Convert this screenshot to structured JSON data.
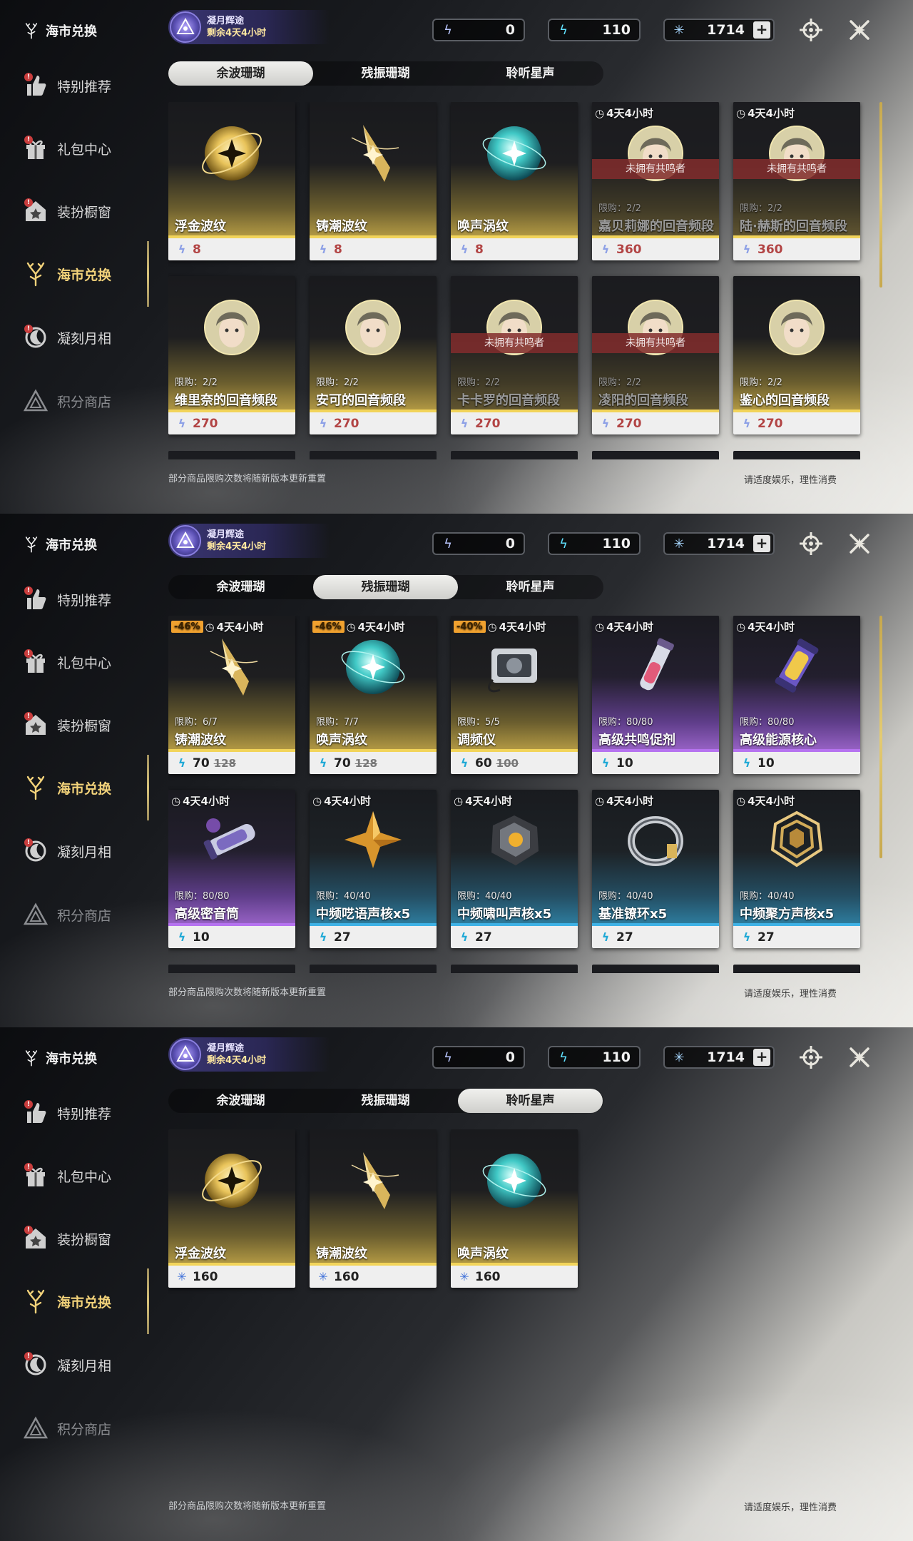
{
  "sidebar": {
    "title": "海市兑换",
    "items": [
      {
        "label": "特别推荐",
        "icon": "recommend-icon",
        "badge": "!",
        "state": "normal"
      },
      {
        "label": "礼包中心",
        "icon": "gift-icon",
        "badge": "!",
        "state": "normal"
      },
      {
        "label": "装扮橱窗",
        "icon": "wardrobe-icon",
        "badge": "!",
        "state": "normal"
      },
      {
        "label": "海市兑换",
        "icon": "coral-icon",
        "badge": "",
        "state": "active"
      },
      {
        "label": "凝刻月相",
        "icon": "moon-icon",
        "badge": "!",
        "state": "normal"
      },
      {
        "label": "积分商店",
        "icon": "points-icon",
        "badge": "",
        "state": "dim"
      }
    ]
  },
  "event": {
    "title": "凝月辉途",
    "subtitle": "剩余4天4小时"
  },
  "currencies": [
    {
      "icon": "afterglow-coral-icon",
      "value": "0"
    },
    {
      "icon": "oscillated-coral-icon",
      "value": "110"
    },
    {
      "icon": "star-currency-icon",
      "value": "1714",
      "plus": "+"
    }
  ],
  "tabs": [
    "余波珊瑚",
    "残振珊瑚",
    "聆听星声"
  ],
  "footer": {
    "note": "部分商品限购次数将随新版本更新重置",
    "advice": "请适度娱乐，理性消费"
  },
  "colors": {
    "gold": "#f2d45a",
    "purple": "#b673f0",
    "blue": "#3fb2e6",
    "active": "#f2d27a",
    "lock": "#822d2d"
  },
  "panels": [
    {
      "active_tab": 0,
      "cards": [
        {
          "name": "浮金波纹",
          "price": "8",
          "rarity": "gold",
          "icon": "golden-orb-icon"
        },
        {
          "name": "铸潮波纹",
          "price": "8",
          "rarity": "gold",
          "icon": "golden-blade-icon"
        },
        {
          "name": "唤声涡纹",
          "price": "8",
          "rarity": "gold",
          "icon": "teal-orb-icon"
        },
        {
          "name": "嘉贝莉娜的回音频段",
          "price": "360",
          "rarity": "gold",
          "timer": "4天4小时",
          "limit": "限购：2/2",
          "lock": "未拥有共鸣者",
          "icon": "portrait-icon"
        },
        {
          "name": "陆·赫斯的回音频段",
          "price": "360",
          "rarity": "gold",
          "timer": "4天4小时",
          "limit": "限购：2/2",
          "lock": "未拥有共鸣者",
          "icon": "portrait-icon"
        },
        {
          "name": "维里奈的回音频段",
          "price": "270",
          "rarity": "gold",
          "limit": "限购：2/2",
          "icon": "portrait-icon"
        },
        {
          "name": "安可的回音频段",
          "price": "270",
          "rarity": "gold",
          "limit": "限购：2/2",
          "icon": "portrait-icon"
        },
        {
          "name": "卡卡罗的回音频段",
          "price": "270",
          "rarity": "gold",
          "limit": "限购：2/2",
          "lock": "未拥有共鸣者",
          "icon": "portrait-icon"
        },
        {
          "name": "凌阳的回音频段",
          "price": "270",
          "rarity": "gold",
          "limit": "限购：2/2",
          "lock": "未拥有共鸣者",
          "icon": "portrait-icon"
        },
        {
          "name": "鉴心的回音频段",
          "price": "270",
          "rarity": "gold",
          "limit": "限购：2/2",
          "icon": "portrait-icon"
        }
      ]
    },
    {
      "active_tab": 1,
      "cards": [
        {
          "name": "铸潮波纹",
          "price": "70",
          "old_price": "128",
          "discount": "-46%",
          "timer": "4天4小时",
          "limit": "限购：6/7",
          "rarity": "gold",
          "icon": "golden-blade-icon"
        },
        {
          "name": "唤声涡纹",
          "price": "70",
          "old_price": "128",
          "discount": "-46%",
          "timer": "4天4小时",
          "limit": "限购：7/7",
          "rarity": "gold",
          "icon": "teal-orb-icon"
        },
        {
          "name": "调频仪",
          "price": "60",
          "old_price": "100",
          "discount": "-40%",
          "timer": "4天4小时",
          "limit": "限购：5/5",
          "rarity": "gold",
          "icon": "tuner-device-icon"
        },
        {
          "name": "高级共鸣促剂",
          "price": "10",
          "timer": "4天4小时",
          "limit": "限购：80/80",
          "rarity": "purple",
          "icon": "vial-icon"
        },
        {
          "name": "高级能源核心",
          "price": "10",
          "timer": "4天4小时",
          "limit": "限购：80/80",
          "rarity": "purple",
          "icon": "energy-core-icon"
        },
        {
          "name": "高级密音筒",
          "price": "10",
          "timer": "4天4小时",
          "limit": "限购：80/80",
          "rarity": "purple",
          "icon": "cylinder-icon"
        },
        {
          "name": "中频呓语声核x5",
          "price": "27",
          "timer": "4天4小时",
          "limit": "限购：40/40",
          "rarity": "blue",
          "icon": "star-shard-icon"
        },
        {
          "name": "中频啸叫声核x5",
          "price": "27",
          "timer": "4天4小时",
          "limit": "限购：40/40",
          "rarity": "blue",
          "icon": "dark-core-icon"
        },
        {
          "name": "基准镣环x5",
          "price": "27",
          "timer": "4天4小时",
          "limit": "限购：40/40",
          "rarity": "blue",
          "icon": "ring-icon"
        },
        {
          "name": "中频聚方声核x5",
          "price": "27",
          "timer": "4天4小时",
          "limit": "限购：40/40",
          "rarity": "blue",
          "icon": "cube-core-icon"
        }
      ]
    },
    {
      "active_tab": 2,
      "cards": [
        {
          "name": "浮金波纹",
          "price": "160",
          "rarity": "gold",
          "icon": "golden-orb-icon"
        },
        {
          "name": "铸潮波纹",
          "price": "160",
          "rarity": "gold",
          "icon": "golden-blade-icon"
        },
        {
          "name": "唤声涡纹",
          "price": "160",
          "rarity": "gold",
          "icon": "teal-orb-icon"
        }
      ]
    }
  ]
}
